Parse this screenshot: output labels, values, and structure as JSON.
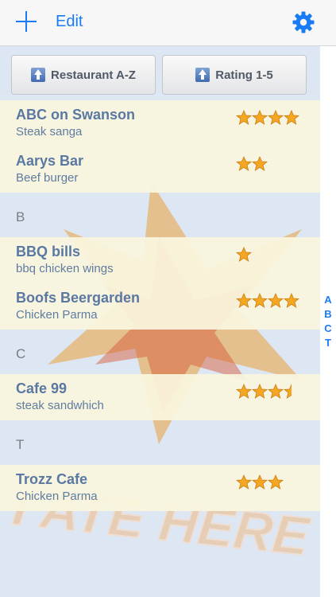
{
  "nav": {
    "edit_label": "Edit"
  },
  "sort": {
    "restaurant_label": "Restaurant A-Z",
    "rating_label": "Rating 1-5"
  },
  "sections": [
    {
      "header": "",
      "items": [
        {
          "name": "ABC on Swanson",
          "dish": "Steak sanga",
          "rating": 4
        },
        {
          "name": "Aarys Bar",
          "dish": "Beef burger",
          "rating": 2
        }
      ]
    },
    {
      "header": "B",
      "items": [
        {
          "name": "BBQ bills",
          "dish": "bbq chicken wings",
          "rating": 1
        },
        {
          "name": "Boofs Beergarden",
          "dish": "Chicken Parma",
          "rating": 4
        }
      ]
    },
    {
      "header": "C",
      "items": [
        {
          "name": "Cafe 99",
          "dish": "steak sandwhich",
          "rating": 3.5
        }
      ]
    },
    {
      "header": "T",
      "items": [
        {
          "name": "Trozz Cafe",
          "dish": "Chicken Parma",
          "rating": 3
        }
      ]
    }
  ],
  "index_letters": [
    "A",
    "B",
    "C",
    "T"
  ],
  "background_text": "I ATE HERE",
  "colors": {
    "accent": "#1a7cf4",
    "row_background": "#f9f5de",
    "name_text": "#5a78a2",
    "star": "#f5a623"
  },
  "icons": {
    "add": "plus-icon",
    "settings": "gear-icon",
    "sort": "up-arrow-icon",
    "rating": "star-icon"
  }
}
